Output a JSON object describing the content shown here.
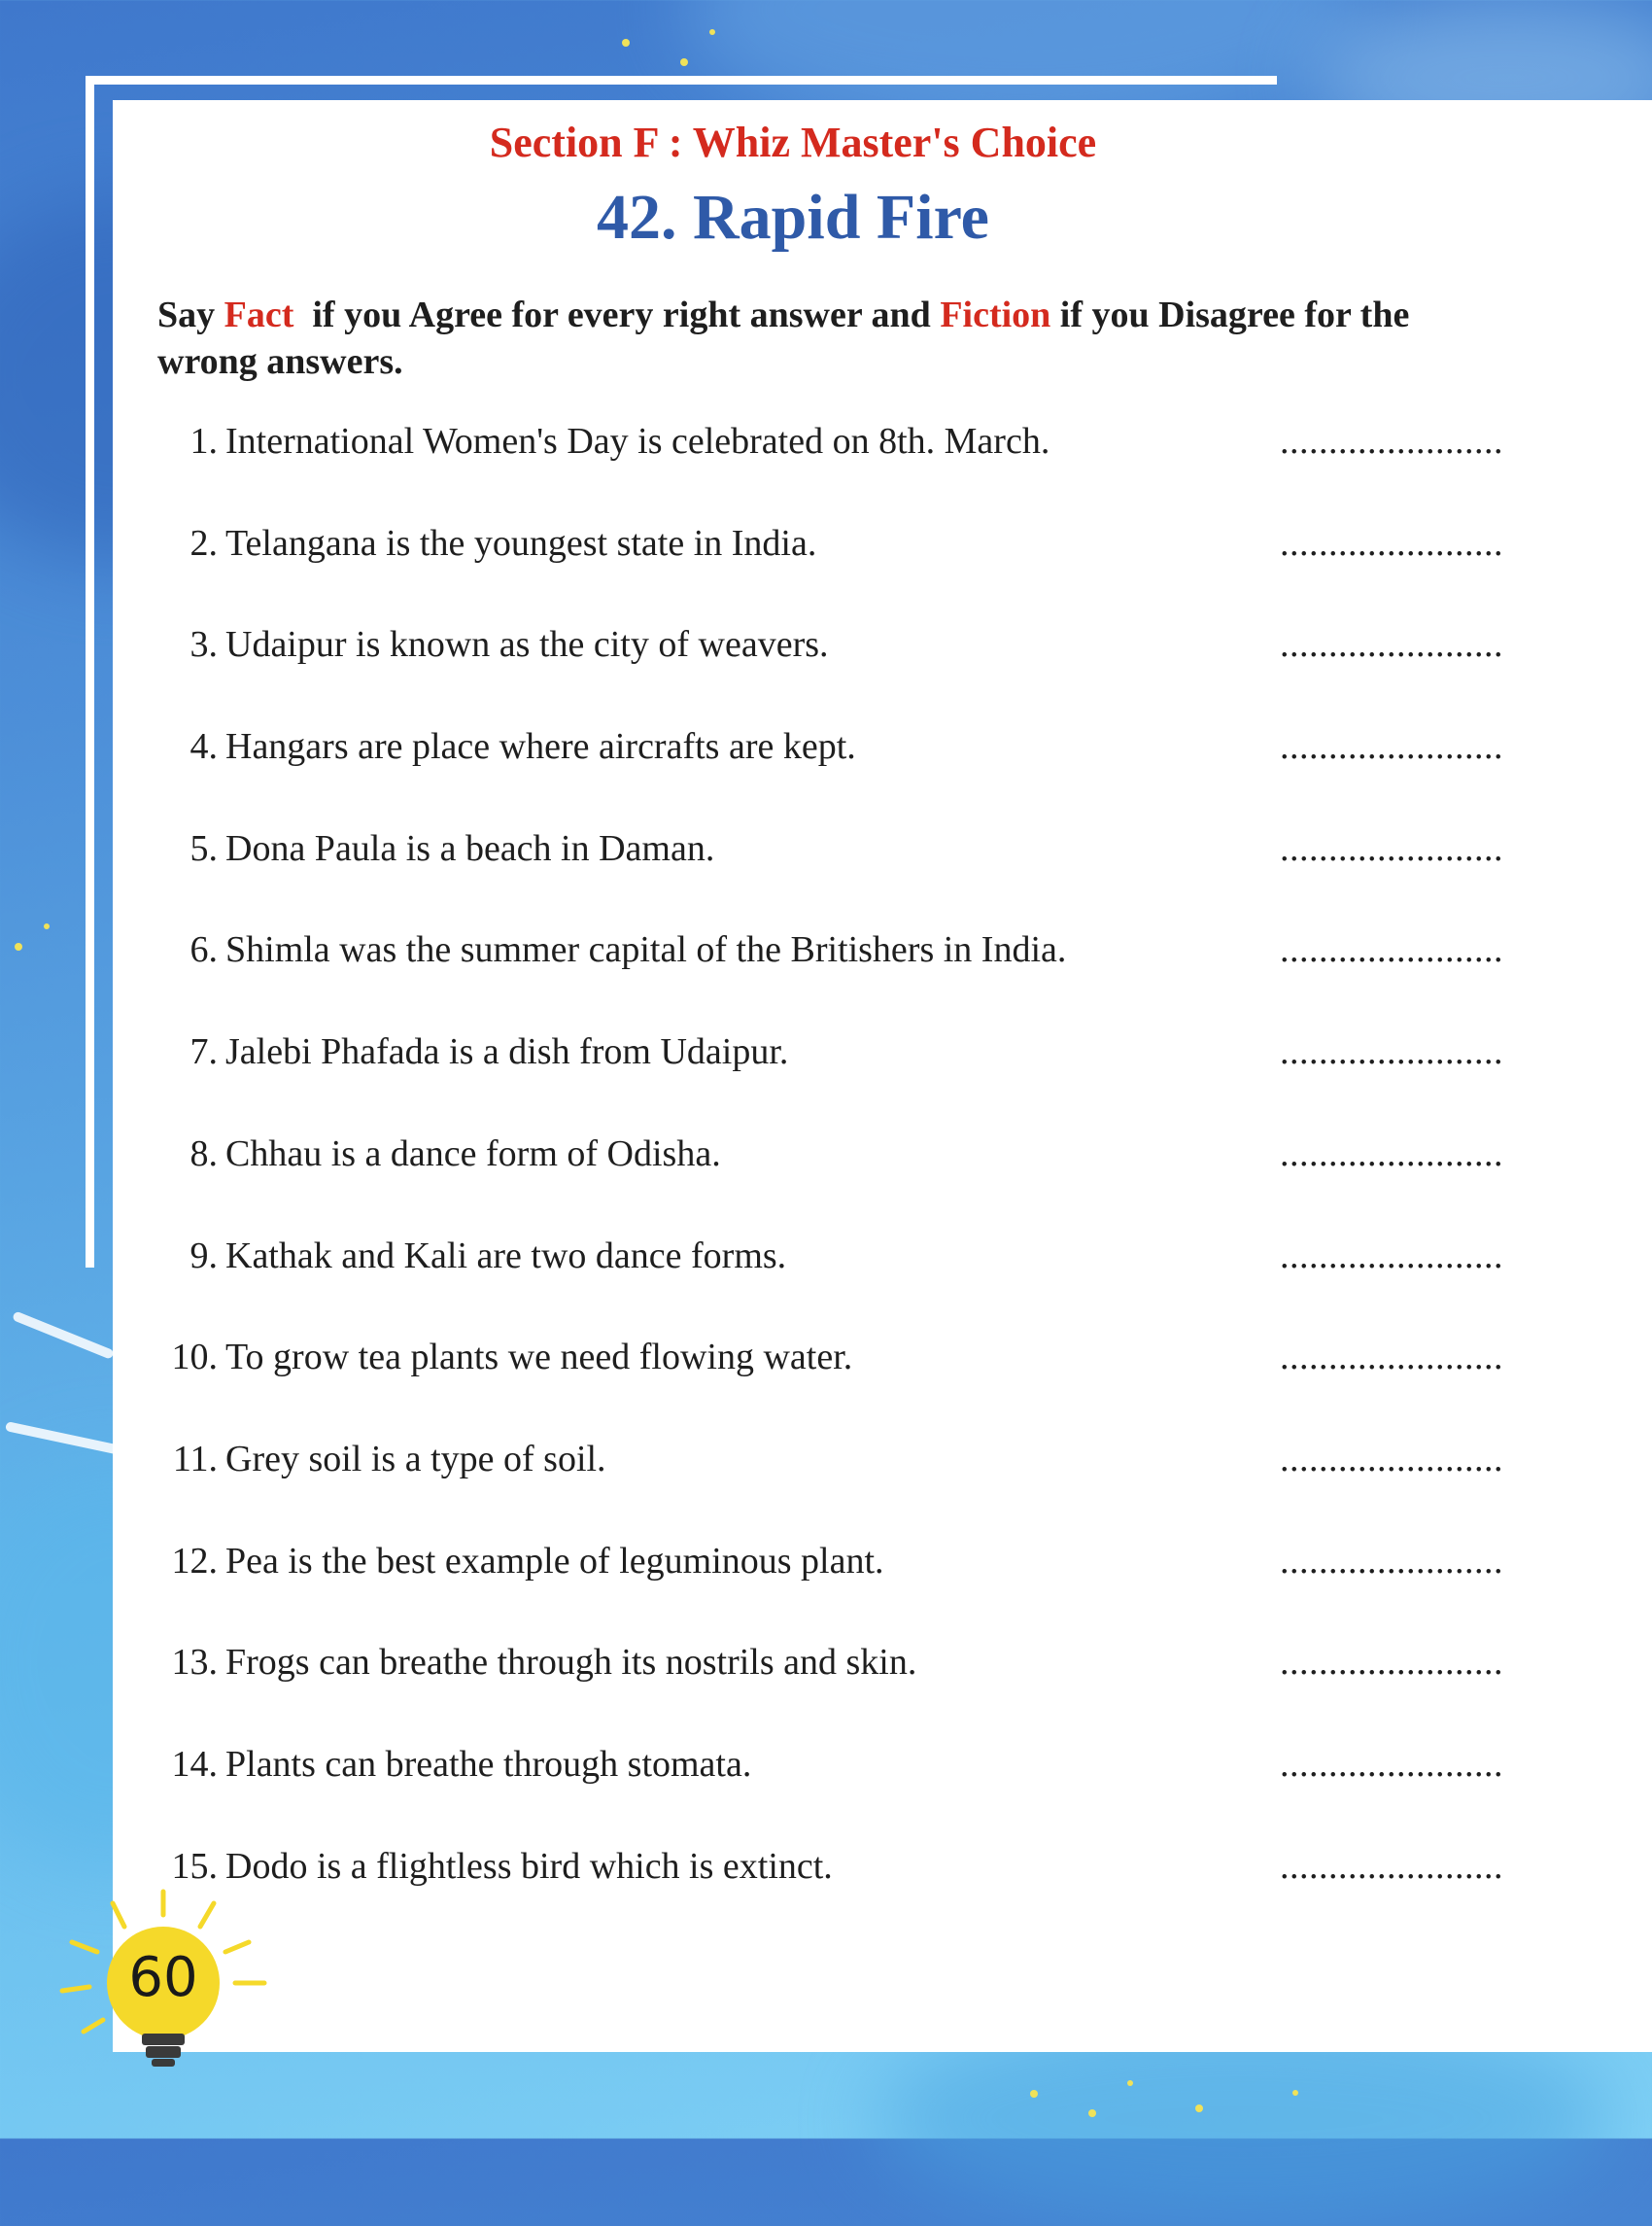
{
  "header": {
    "section_label": "Section F :  Whiz Master's Choice",
    "title": "42. Rapid Fire"
  },
  "instructions": {
    "part1": "Say ",
    "fact_word": "Fact",
    "part2": "  if you Agree for every right answer and ",
    "fiction_word": "Fiction",
    "part3": " if you Disagree for the wrong answers."
  },
  "questions": [
    {
      "num": "1.",
      "text": "International Women's Day is celebrated on 8th. March.",
      "blank": "......................."
    },
    {
      "num": "2.",
      "text": "Telangana is the youngest state in India.",
      "blank": "......................."
    },
    {
      "num": "3.",
      "text": "Udaipur is known as the city of weavers.",
      "blank": "......................."
    },
    {
      "num": "4.",
      "text": "Hangars are place where aircrafts are kept.",
      "blank": "......................."
    },
    {
      "num": "5.",
      "text": "Dona Paula is a beach in Daman.",
      "blank": "......................."
    },
    {
      "num": "6.",
      "text": "Shimla was the summer capital of the Britishers in India.",
      "blank": "......................."
    },
    {
      "num": "7.",
      "text": "Jalebi Phafada is a dish from Udaipur.",
      "blank": "......................."
    },
    {
      "num": "8.",
      "text": "Chhau is a dance form of Odisha.",
      "blank": "......................."
    },
    {
      "num": "9.",
      "text": "Kathak and Kali are two dance forms.",
      "blank": "......................."
    },
    {
      "num": "10.",
      "text": "To grow tea plants we need flowing water.",
      "blank": "......................."
    },
    {
      "num": "11.",
      "text": "Grey soil is a type of soil.",
      "blank": "......................."
    },
    {
      "num": "12.",
      "text": "Pea is the best example of leguminous plant.",
      "blank": "......................."
    },
    {
      "num": "13.",
      "text": "Frogs can breathe through its nostrils and skin.",
      "blank": "......................."
    },
    {
      "num": "14.",
      "text": "Plants can breathe through stomata.",
      "blank": "......................."
    },
    {
      "num": "15.",
      "text": "Dodo is a flightless bird which is extinct.",
      "blank": "......................."
    }
  ],
  "footer": {
    "page_number": "60"
  },
  "colors": {
    "accent_red": "#d42a1e",
    "title_blue": "#2f5aa8",
    "bulb_yellow": "#f5d92a"
  }
}
